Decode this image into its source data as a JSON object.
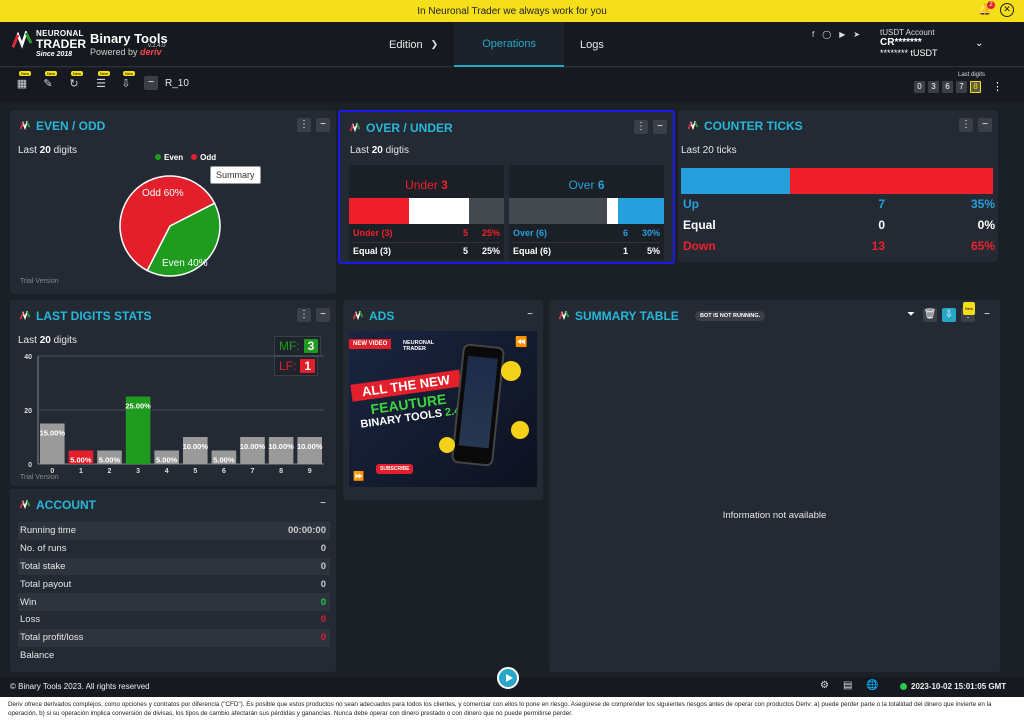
{
  "banner": {
    "text": "In Neuronal Trader we always work for you",
    "notif_count": "2"
  },
  "header": {
    "logo_l1": "NEURONAL",
    "logo_l2": "TRADER",
    "logo_l3": "Since 2018",
    "app_name": "Binary Tools",
    "version": "v.2.4.0",
    "powered": "Powered by",
    "powered_brand": "deriv",
    "nav": [
      {
        "label": "Edition"
      },
      {
        "label": "Operations"
      },
      {
        "label": "Logs"
      }
    ],
    "account_type": "tUSDT Account",
    "account_id": "CR*******",
    "balance": "******** tUSDT"
  },
  "toolbar": {
    "new_badge": "New",
    "symbol": "R_10",
    "last_digits_label": "Last digits",
    "last_digits": [
      "0",
      "3",
      "6",
      "7",
      "8"
    ]
  },
  "even_odd": {
    "title": "EVEN / ODD",
    "subtitle_pre": "Last",
    "subtitle_num": "20",
    "subtitle_post": "digits",
    "legend_even": "Even",
    "legend_odd": "Odd",
    "tooltip": "Summary",
    "odd_label": "Odd 60%",
    "even_label": "Even 40%",
    "trial": "Trial Version",
    "odd_pct": 60,
    "even_pct": 40
  },
  "over_under": {
    "title": "OVER / UNDER",
    "subtitle_pre": "Last",
    "subtitle_num": "20",
    "subtitle_post": "digtis",
    "under_word": "Under",
    "under_digit": "3",
    "over_word": "Over",
    "over_digit": "6",
    "under_row": {
      "label": "Under (3)",
      "count": "5",
      "pct": "25%"
    },
    "under_equal": {
      "label": "Equal (3)",
      "count": "5",
      "pct": "25%"
    },
    "over_row": {
      "label": "Over (6)",
      "count": "6",
      "pct": "30%"
    },
    "over_equal": {
      "label": "Equal (6)",
      "count": "1",
      "pct": "5%"
    },
    "under_fill": 0.25,
    "under_equal_fill": 0.25,
    "over_fill": 0.3,
    "over_equal_fill": 0.05
  },
  "counter_ticks": {
    "title": "COUNTER TICKS",
    "subtitle": "Last 20 ticks",
    "up_fill": 0.35,
    "rows": [
      {
        "label": "Up",
        "count": "7",
        "pct": "35%",
        "color": "#26a0dc"
      },
      {
        "label": "Equal",
        "count": "0",
        "pct": "0%",
        "color": "#ffffff"
      },
      {
        "label": "Down",
        "count": "13",
        "pct": "65%",
        "color": "#f0202a"
      }
    ]
  },
  "digit_stats": {
    "title": "LAST DIGITS STATS",
    "subtitle_pre": "Last",
    "subtitle_num": "20",
    "subtitle_post": "digits",
    "mf_label": "MF:",
    "mf_value": "3",
    "lf_label": "LF:",
    "lf_value": "1",
    "trial": "Trial Version"
  },
  "chart_data": {
    "type": "bar",
    "categories": [
      "0",
      "1",
      "2",
      "3",
      "4",
      "5",
      "6",
      "7",
      "8",
      "9"
    ],
    "values": [
      15,
      5,
      5,
      25,
      5,
      10,
      5,
      10,
      10,
      10
    ],
    "data_labels": [
      "15.00%",
      "5.00%",
      "5.00%",
      "25.00%",
      "5.00%",
      "10.00%",
      "5.00%",
      "10.00%",
      "10.00%",
      "10.00%"
    ],
    "yticks": [
      "0",
      "20",
      "40"
    ],
    "ylim": [
      0,
      40
    ],
    "colors": {
      "default": "#9a9a9a",
      "max": "#1f9b1f",
      "min": "#e21f2a"
    },
    "max_index": 3,
    "min_index": 1
  },
  "ads": {
    "title": "ADS",
    "tag": "NEW VIDEO",
    "brand": "NEURONAL TRADER",
    "line1": "ALL THE NEW",
    "line2": "FEAUTURE",
    "line3": "BINARY TOOLS",
    "line3b": "2.4",
    "subscribe": "SUBSCRIBE"
  },
  "summary": {
    "title": "SUMMARY TABLE",
    "status": "BOT IS NOT RUNNING.",
    "empty": "Information not available"
  },
  "account": {
    "title": "ACCOUNT",
    "rows": [
      {
        "label": "Running time",
        "value": "00:00:00",
        "color": "#cccccc"
      },
      {
        "label": "No. of runs",
        "value": "0",
        "color": "#cccccc"
      },
      {
        "label": "Total stake",
        "value": "0",
        "color": "#cccccc"
      },
      {
        "label": "Total payout",
        "value": "0",
        "color": "#cccccc"
      },
      {
        "label": "Win",
        "value": "0",
        "color": "#26c94b"
      },
      {
        "label": "Loss",
        "value": "0",
        "color": "#e21f2a"
      },
      {
        "label": "Total profit/loss",
        "value": "0",
        "color": "#e21f2a"
      },
      {
        "label": "Balance",
        "value": "",
        "color": "#cccccc"
      }
    ]
  },
  "footer": {
    "copyright": "© Binary Tools 2023. All rights reserved",
    "datetime": "2023-10-02 15:01:05 GMT",
    "disclaimer": "Deriv ofrece derivados complejos, como opciones y contratos por diferencia (\"CFD\"). Es posible que estos productos no sean adecuados para todos los clientes, y comerciar con ellos lo pone en riesgo. Asegúrese de comprender los siguientes riesgos antes de operar con productos Deriv: a) puede perder parte o la totalidad del dinero que invierte en la operación, b) si su operación implica conversión de divisas, los tipos de cambio afectarán sus pérdidas y ganancias. Nunca debe operar con dinero prestado o con dinero que no puede permitirse perder."
  }
}
